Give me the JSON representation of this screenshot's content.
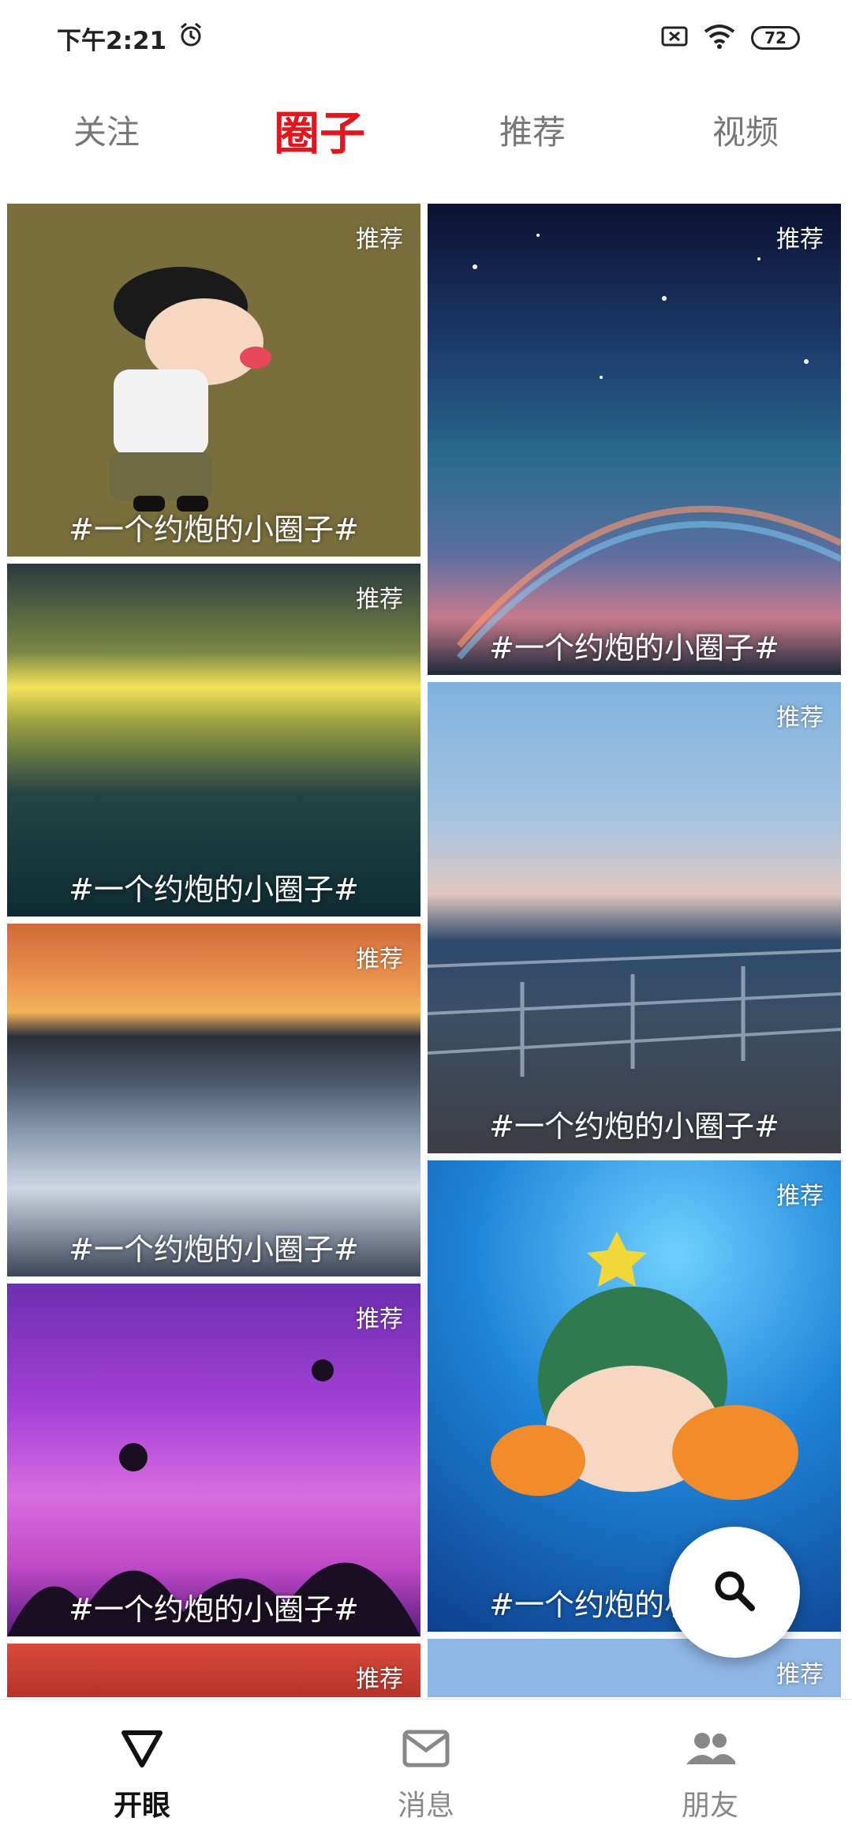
{
  "status_bar": {
    "time": "下午2:21",
    "battery": "72",
    "icons": [
      "alarm-icon",
      "sim-off-icon",
      "wifi-icon",
      "battery-icon"
    ]
  },
  "tabs": [
    {
      "label": "关注",
      "active": false
    },
    {
      "label": "圈子",
      "active": true
    },
    {
      "label": "推荐",
      "active": false
    },
    {
      "label": "视频",
      "active": false
    }
  ],
  "colors": {
    "active_tab": "#e5141d",
    "nav_active": "#111111",
    "nav_inactive": "#888888"
  },
  "feed": {
    "cards": [
      {
        "badge": "推荐",
        "title": "#一个约炮的小圈子#"
      },
      {
        "badge": "推荐",
        "title": "#一个约炮的小圈子#"
      },
      {
        "badge": "推荐",
        "title": "#一个约炮的小圈子#"
      },
      {
        "badge": "推荐",
        "title": "#一个约炮的小圈子#"
      },
      {
        "badge": "推荐",
        "title": ""
      },
      {
        "badge": "推荐",
        "title": "#一个约炮的小圈子#"
      },
      {
        "badge": "推荐",
        "title": "#一个约炮的小圈子#"
      },
      {
        "badge": "推荐",
        "title": "#一个约炮的小圈子#"
      },
      {
        "badge": "推荐",
        "title": ""
      }
    ]
  },
  "fab": {
    "icon": "search-icon"
  },
  "bottom_nav": [
    {
      "label": "开眼",
      "icon": "triangle-logo-icon",
      "active": true
    },
    {
      "label": "消息",
      "icon": "mail-icon",
      "active": false
    },
    {
      "label": "朋友",
      "icon": "people-icon",
      "active": false
    }
  ]
}
